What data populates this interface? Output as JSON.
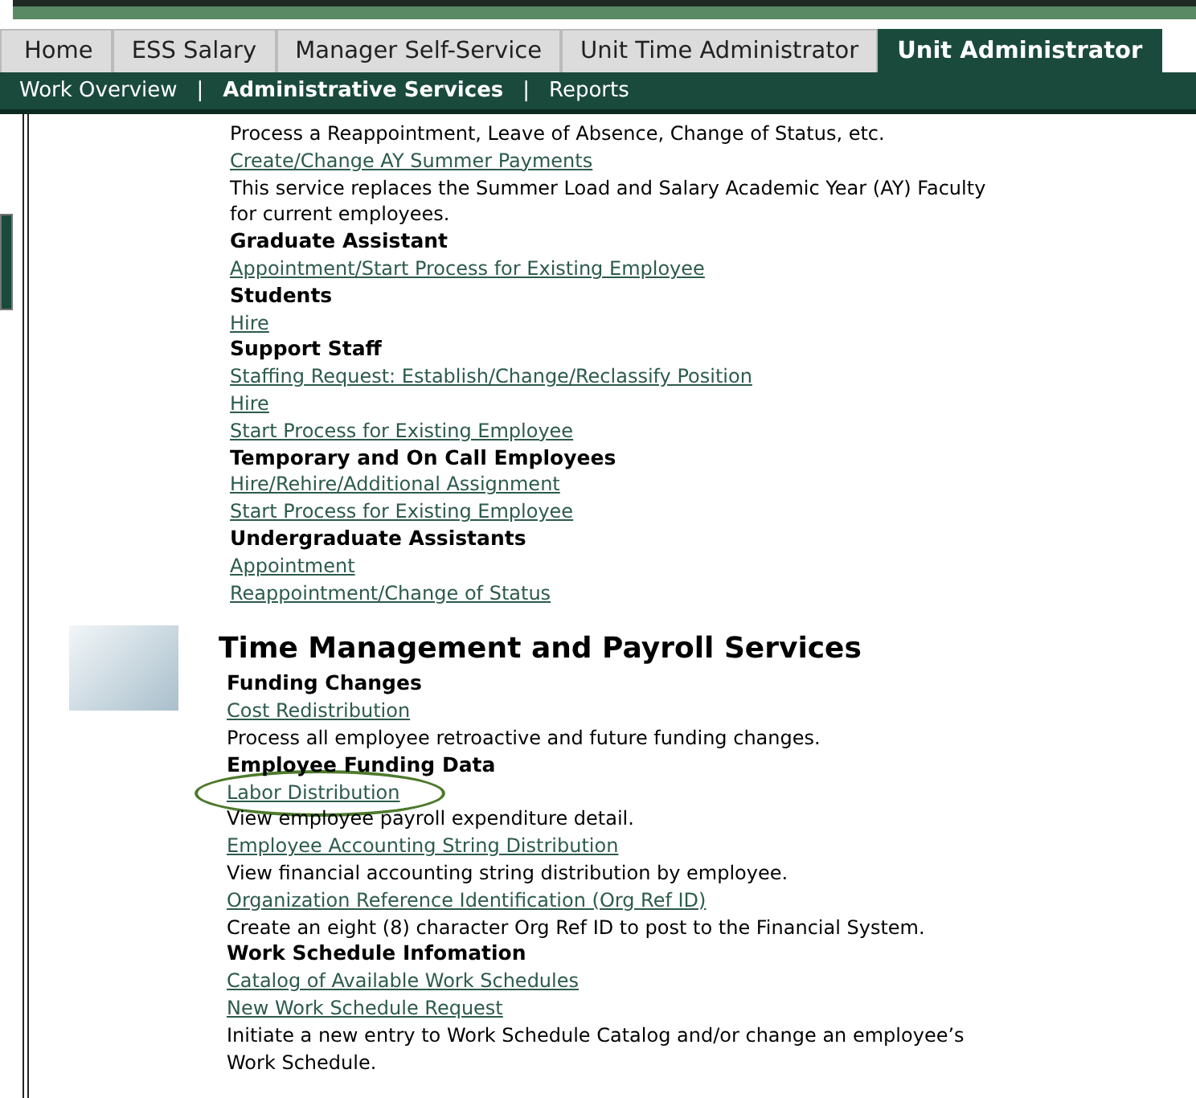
{
  "tabs": [
    {
      "label": "Home",
      "selected": false
    },
    {
      "label": "ESS Salary",
      "selected": false
    },
    {
      "label": "Manager Self-Service",
      "selected": false
    },
    {
      "label": "Unit Time Administrator",
      "selected": false
    },
    {
      "label": "Unit Administrator",
      "selected": true
    }
  ],
  "subnav": [
    {
      "label": "Work Overview",
      "selected": false
    },
    {
      "label": "Administrative Services",
      "selected": true
    },
    {
      "label": "Reports",
      "selected": false
    }
  ],
  "subnav_separator": "|",
  "sections": [
    {
      "items": [
        {
          "kind": "text",
          "text": "Process a Reappointment, Leave of Absence, Change of Status, etc."
        },
        {
          "kind": "link",
          "text": "Create/Change AY Summer Payments"
        },
        {
          "kind": "text",
          "text": "This service replaces the Summer Load and Salary Academic Year (AY) Faculty for current employees."
        },
        {
          "kind": "heading",
          "text": "Graduate Assistant"
        },
        {
          "kind": "link",
          "text": "Appointment/Start Process for Existing Employee"
        },
        {
          "kind": "heading",
          "text": "Students"
        },
        {
          "kind": "link",
          "text": "Hire"
        },
        {
          "kind": "heading",
          "text": "Support Staff"
        },
        {
          "kind": "link",
          "text": "Staffing Request: Establish/Change/Reclassify Position"
        },
        {
          "kind": "link",
          "text": "Hire"
        },
        {
          "kind": "link",
          "text": "Start Process for Existing Employee"
        },
        {
          "kind": "heading",
          "text": "Temporary and On Call Employees"
        },
        {
          "kind": "link",
          "text": "Hire/Rehire/Additional Assignment"
        },
        {
          "kind": "link",
          "text": "Start Process for Existing Employee"
        },
        {
          "kind": "heading",
          "text": "Undergraduate Assistants"
        },
        {
          "kind": "link",
          "text": "Appointment"
        },
        {
          "kind": "link",
          "text": "Reappointment/Change of Status"
        }
      ]
    },
    {
      "title": "Time Management and Payroll Services",
      "items": [
        {
          "kind": "heading",
          "text": "Funding Changes"
        },
        {
          "kind": "link",
          "text": "Cost Redistribution"
        },
        {
          "kind": "text",
          "text": "Process all employee retroactive and future funding changes."
        },
        {
          "kind": "heading",
          "text": "Employee Funding Data"
        },
        {
          "kind": "link",
          "text": "Labor Distribution",
          "circled": true
        },
        {
          "kind": "text",
          "text": "View employee payroll expenditure detail."
        },
        {
          "kind": "link",
          "text": "Employee Accounting String Distribution"
        },
        {
          "kind": "text",
          "text": "View financial accounting string distribution by employee."
        },
        {
          "kind": "link",
          "text": "Organization Reference Identification (Org Ref ID)"
        },
        {
          "kind": "text",
          "text": "Create an eight (8) character Org Ref ID to post to the Financial System."
        },
        {
          "kind": "heading",
          "text": "Work Schedule Infomation"
        },
        {
          "kind": "link",
          "text": "Catalog of Available Work Schedules"
        },
        {
          "kind": "link",
          "text": "New Work Schedule Request"
        },
        {
          "kind": "text",
          "text": "Initiate a new entry to Work Schedule Catalog and/or change an employee’s Work Schedule."
        }
      ]
    }
  ]
}
